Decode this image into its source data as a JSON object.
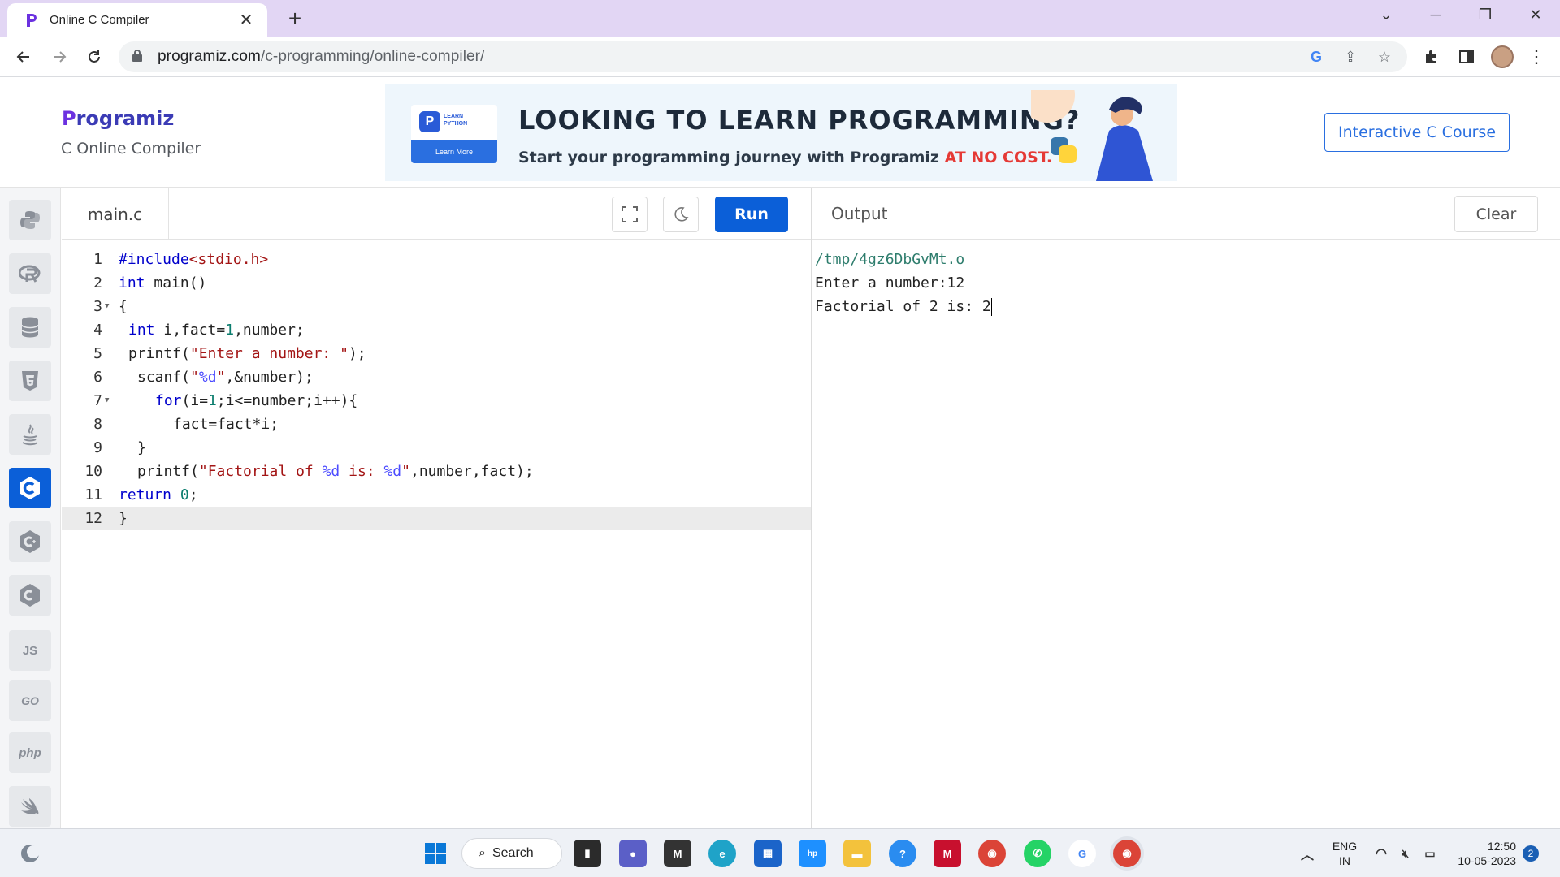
{
  "browser": {
    "tab_title": "Online C Compiler",
    "url_host": "programiz.com",
    "url_path": "/c-programming/online-compiler/"
  },
  "site": {
    "logo_text": "rogramiz",
    "logo_letter": "P",
    "subtitle": "C Online Compiler",
    "course_button": "Interactive C Course"
  },
  "banner": {
    "card_line1": "LEARN",
    "card_line2": "PYTHON",
    "card_button": "Learn More",
    "headline": "LOOKING TO LEARN PROGRAMMING?",
    "sub_start": "Start your programming journey with Programiz ",
    "sub_highlight": "AT NO COST."
  },
  "languages": [
    {
      "name": "python",
      "icon": "python-icon"
    },
    {
      "name": "r",
      "icon": "r-icon"
    },
    {
      "name": "sql",
      "icon": "database-icon"
    },
    {
      "name": "html",
      "icon": "html5-icon"
    },
    {
      "name": "java",
      "icon": "java-icon"
    },
    {
      "name": "c",
      "icon": "c-icon",
      "active": true
    },
    {
      "name": "cpp",
      "icon": "cpp-icon"
    },
    {
      "name": "csharp",
      "icon": "csharp-icon"
    },
    {
      "name": "js",
      "label": "JS"
    },
    {
      "name": "go",
      "label": "GO"
    },
    {
      "name": "php",
      "label": "php"
    },
    {
      "name": "swift",
      "icon": "swift-icon"
    }
  ],
  "editor": {
    "filename": "main.c",
    "run_label": "Run",
    "current_line": 12,
    "lines": [
      {
        "n": "1",
        "fold": false
      },
      {
        "n": "2",
        "fold": false
      },
      {
        "n": "3",
        "fold": true
      },
      {
        "n": "4",
        "fold": false
      },
      {
        "n": "5",
        "fold": false
      },
      {
        "n": "6",
        "fold": false
      },
      {
        "n": "7",
        "fold": true
      },
      {
        "n": "8",
        "fold": false
      },
      {
        "n": "9",
        "fold": false
      },
      {
        "n": "10",
        "fold": false
      },
      {
        "n": "11",
        "fold": false
      },
      {
        "n": "12",
        "fold": false
      }
    ],
    "code": {
      "l1_kw": "#include",
      "l1_str": "<stdio.h>",
      "l2_kw": "int",
      "l2_rest": " main()",
      "l3": "{",
      "l4_kw": "int",
      "l4_a": " i,fact=",
      "l4_num": "1",
      "l4_b": ",number;",
      "l5_a": "printf(",
      "l5_str": "\"Enter a number: \"",
      "l5_b": ");",
      "l6_a": "scanf(",
      "l6_s1": "\"",
      "l6_fmt": "%d",
      "l6_s2": "\"",
      "l6_b": ",&number);",
      "l7_kw": "for",
      "l7_a": "(i=",
      "l7_num": "1",
      "l7_b": ";i<=number;i++){",
      "l8": "fact=fact*i;",
      "l9": "}",
      "l10_a": "printf(",
      "l10_s1": "\"Factorial of ",
      "l10_f1": "%d",
      "l10_s2": " is: ",
      "l10_f2": "%d",
      "l10_s3": "\"",
      "l10_b": ",number,fact);",
      "l11_kw": "return",
      "l11_sp": " ",
      "l11_num": "0",
      "l11_b": ";",
      "l12": "}"
    }
  },
  "output": {
    "title": "Output",
    "clear_label": "Clear",
    "lines": [
      "/tmp/4gz6DbGvMt.o",
      "Enter a number:12",
      "Factorial of 2 is: 2"
    ]
  },
  "taskbar": {
    "search_label": "Search",
    "lang_top": "ENG",
    "lang_bottom": "IN",
    "time": "12:50",
    "date": "10-05-2023",
    "notification_count": "2"
  },
  "colors": {
    "accent": "#0b5fd8",
    "tabbar": "#e2d6f4",
    "logo": "#6b31e0",
    "banner_highlight": "#e53935"
  }
}
